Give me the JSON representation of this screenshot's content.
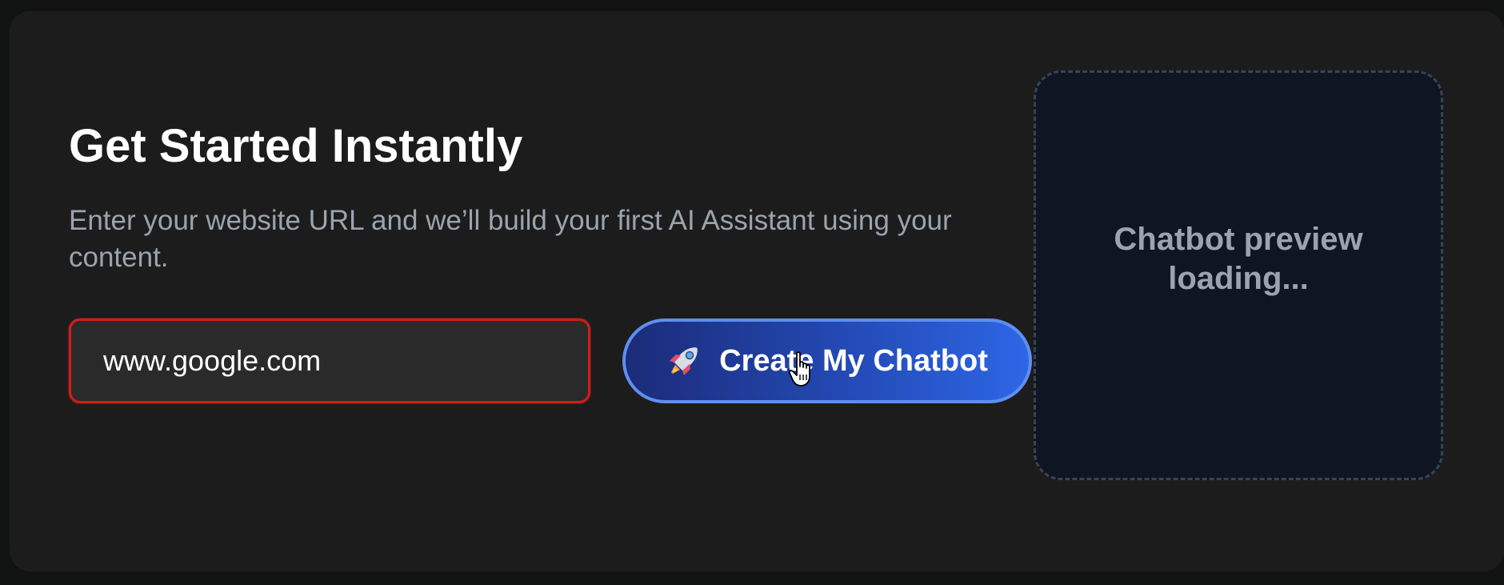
{
  "hero": {
    "title": "Get Started Instantly",
    "subtitle": "Enter your website URL and we’ll build your first AI Assistant using your content."
  },
  "form": {
    "url_value": "www.google.com",
    "submit_label": "Create My Chatbot",
    "submit_icon": "rocket-icon"
  },
  "preview": {
    "status_text": "Chatbot preview loading..."
  },
  "colors": {
    "background": "#111313",
    "card": "#1c1c1c",
    "input_border_error": "#cf1d1d",
    "button_gradient_start": "#1b2b78",
    "button_gradient_end": "#2d66e6",
    "button_border": "#5e8ff0",
    "preview_background": "#0f1523",
    "muted_text": "#9ba3ae"
  }
}
